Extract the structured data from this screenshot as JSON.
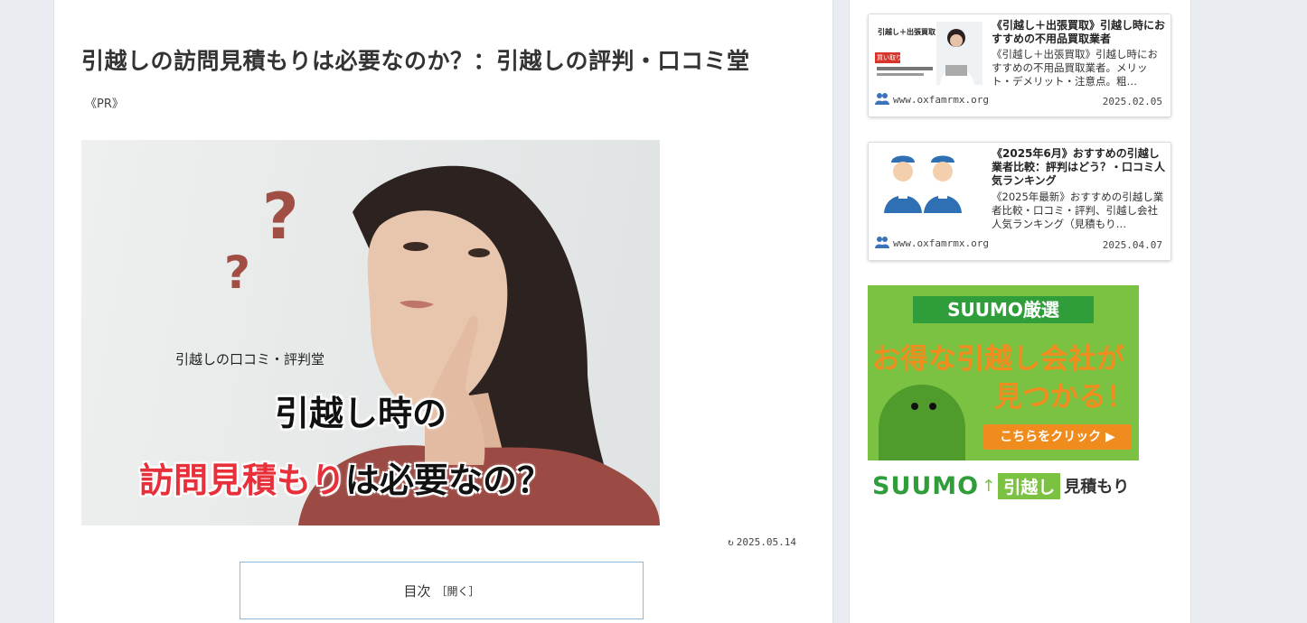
{
  "article": {
    "title": "引越しの訪問見積もりは必要なのか？：引越しの評判・口コミ堂",
    "pr_label": "《PR》",
    "hero": {
      "subtitle": "引越しの口コミ・評判堂",
      "line1": "引越し時の",
      "line2_red": "訪問見積もり",
      "line2_black": "は必要なの？",
      "question_marks": [
        "?",
        "?"
      ]
    },
    "updated_date": "2025.05.14",
    "toc": {
      "label": "目次",
      "toggle": "［開く］"
    }
  },
  "sidebar": {
    "cards": [
      {
        "title": "《引越し＋出張買取》引越し時におすすめの不用品買取業者",
        "description": "《引越し＋出張買取》引越し時におすすめの不用品買取業者。メリット・デメリット・注意点。粗…",
        "site": "www.oxfamrmx.org",
        "date": "2025.02.05",
        "thumb_label": "引越し＋出張買取",
        "thumb_tag": "買い取り"
      },
      {
        "title": "《2025年6月》おすすめの引越し業者比較：評判はどう？・口コミ人気ランキング",
        "description": "《2025年最新》おすすめの引越し業者比較・口コミ・評判、引越し会社人気ランキング（見積もり…",
        "site": "www.oxfamrmx.org",
        "date": "2025.04.07"
      }
    ],
    "ad": {
      "badge": "SUUMO厳選",
      "headline1": "お得な引越し会社が",
      "headline2": "見つかる！",
      "cta": "こちらをクリック",
      "brand": "SUUMO",
      "brand_tag": "引越し",
      "brand_suffix": "見積もり"
    }
  }
}
